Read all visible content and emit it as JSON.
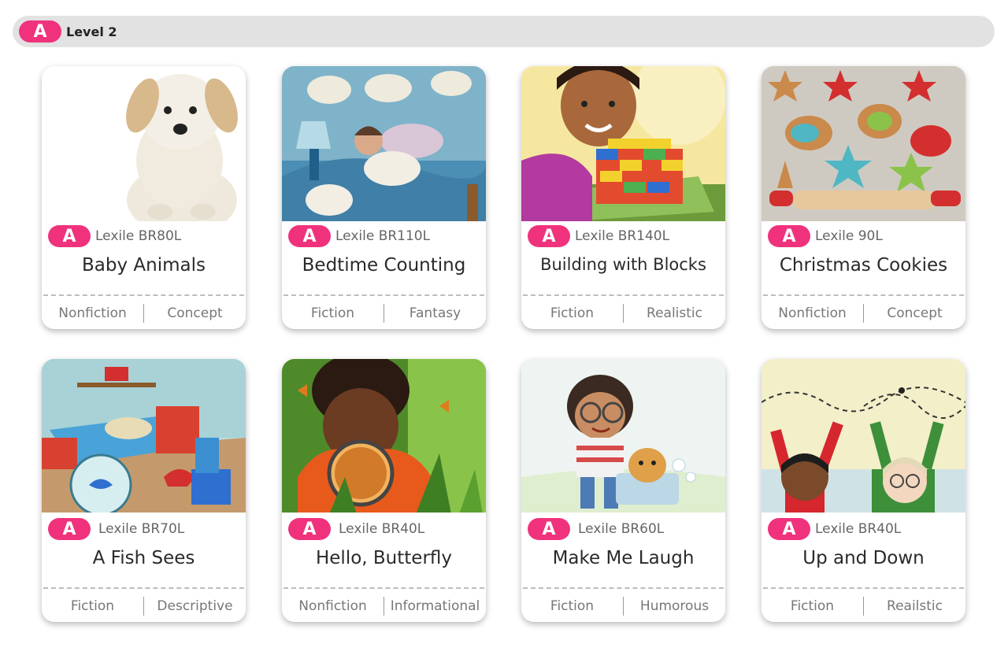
{
  "level": {
    "badge": "A",
    "label": "Level 2"
  },
  "colors": {
    "badge": "#f0327c",
    "bar": "#e2e2e2"
  },
  "books": [
    {
      "badge": "A",
      "lexile": "Lexile BR80L",
      "title": "Baby Animals",
      "tags": [
        "Nonfiction",
        "Concept"
      ],
      "cover": "puppy"
    },
    {
      "badge": "A",
      "lexile": "Lexile BR110L",
      "title": "Bedtime Counting",
      "tags": [
        "Fiction",
        "Fantasy"
      ],
      "cover": "sheep-bedroom"
    },
    {
      "badge": "A",
      "lexile": "Lexile BR140L",
      "title": "Building with Blocks",
      "tags": [
        "Fiction",
        "Realistic"
      ],
      "cover": "girl-blocks"
    },
    {
      "badge": "A",
      "lexile": "Lexile 90L",
      "title": "Christmas Cookies",
      "tags": [
        "Nonfiction",
        "Concept"
      ],
      "cover": "cookies"
    },
    {
      "badge": "A",
      "lexile": "Lexile BR70L",
      "title": "A Fish Sees",
      "tags": [
        "Fiction",
        "Descriptive"
      ],
      "cover": "fishbowl-room"
    },
    {
      "badge": "A",
      "lexile": "Lexile BR40L",
      "title": "Hello, Butterfly",
      "tags": [
        "Nonfiction",
        "Informational"
      ],
      "cover": "boy-magnifier"
    },
    {
      "badge": "A",
      "lexile": "Lexile BR60L",
      "title": "Make Me Laugh",
      "tags": [
        "Fiction",
        "Humorous"
      ],
      "cover": "girl-dog-bath"
    },
    {
      "badge": "A",
      "lexile": "Lexile BR40L",
      "title": "Up and Down",
      "tags": [
        "Fiction",
        "Reailstic"
      ],
      "cover": "kids-arms-up"
    }
  ]
}
